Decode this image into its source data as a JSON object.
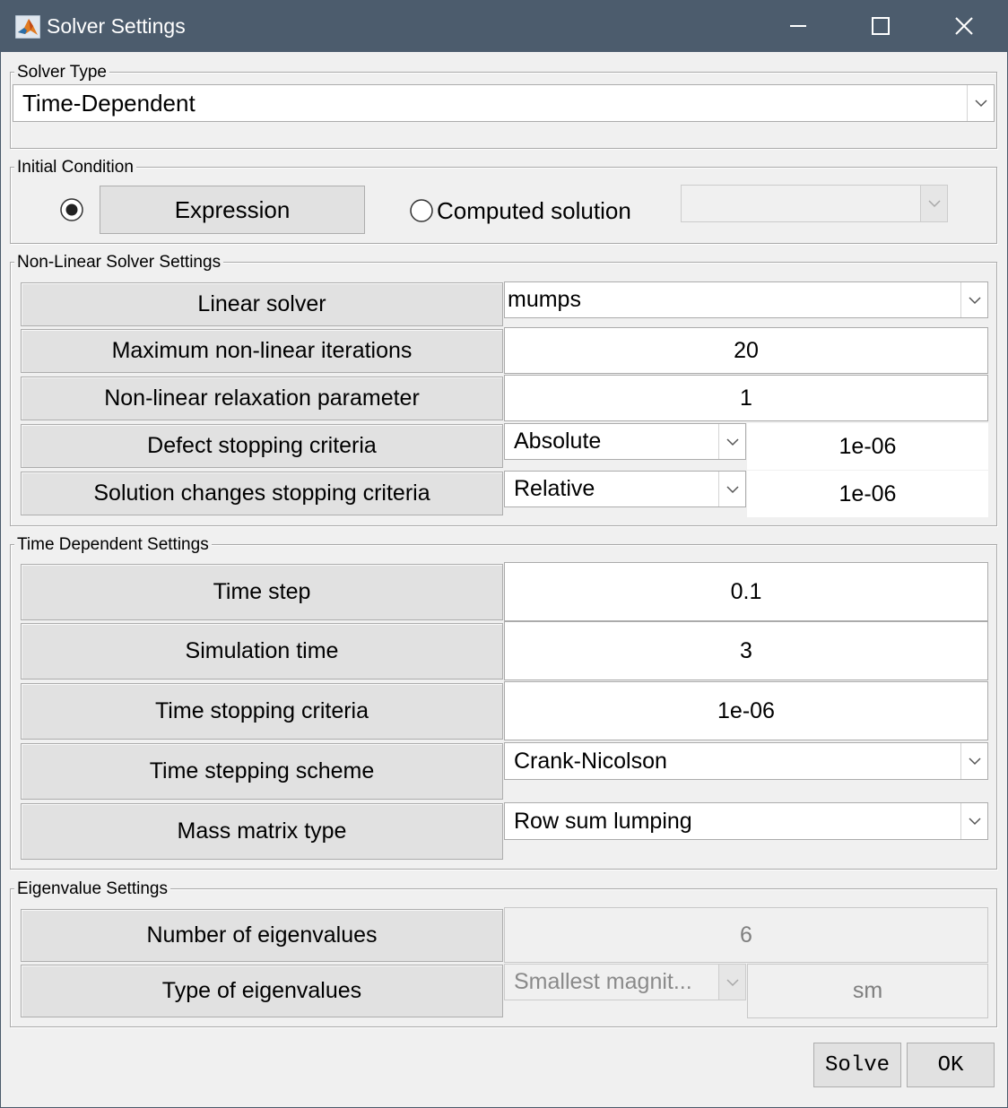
{
  "window": {
    "title": "Solver Settings"
  },
  "solver_type": {
    "legend": "Solver Type",
    "selected": "Time-Dependent"
  },
  "initial_condition": {
    "legend": "Initial Condition",
    "expression_selected": true,
    "expression_button": "Expression",
    "computed_solution_label": "Computed solution",
    "computed_solution_value": ""
  },
  "nonlinear": {
    "legend": "Non-Linear Solver Settings",
    "linear_solver_label": "Linear solver",
    "linear_solver_value": "mumps",
    "max_iter_label": "Maximum non-linear iterations",
    "max_iter_value": "20",
    "relax_label": "Non-linear relaxation parameter",
    "relax_value": "1",
    "defect_label": "Defect stopping criteria",
    "defect_mode": "Absolute",
    "defect_value": "1e-06",
    "solchange_label": "Solution changes stopping criteria",
    "solchange_mode": "Relative",
    "solchange_value": "1e-06"
  },
  "time": {
    "legend": "Time Dependent Settings",
    "step_label": "Time step",
    "step_value": "0.1",
    "sim_label": "Simulation time",
    "sim_value": "3",
    "stop_label": "Time stopping criteria",
    "stop_value": "1e-06",
    "scheme_label": "Time stepping scheme",
    "scheme_value": "Crank-Nicolson",
    "mass_label": "Mass matrix type",
    "mass_value": "Row sum lumping"
  },
  "eigen": {
    "legend": "Eigenvalue Settings",
    "num_label": "Number of eigenvalues",
    "num_value": "6",
    "type_label": "Type of eigenvalues",
    "type_value": "Smallest magnit...",
    "type_code": "sm"
  },
  "buttons": {
    "solve": "Solve",
    "ok": "OK"
  },
  "colors": {
    "titlebar": "#4c5c6d",
    "client": "#f0f0f0",
    "label_bg": "#e1e1e1"
  }
}
